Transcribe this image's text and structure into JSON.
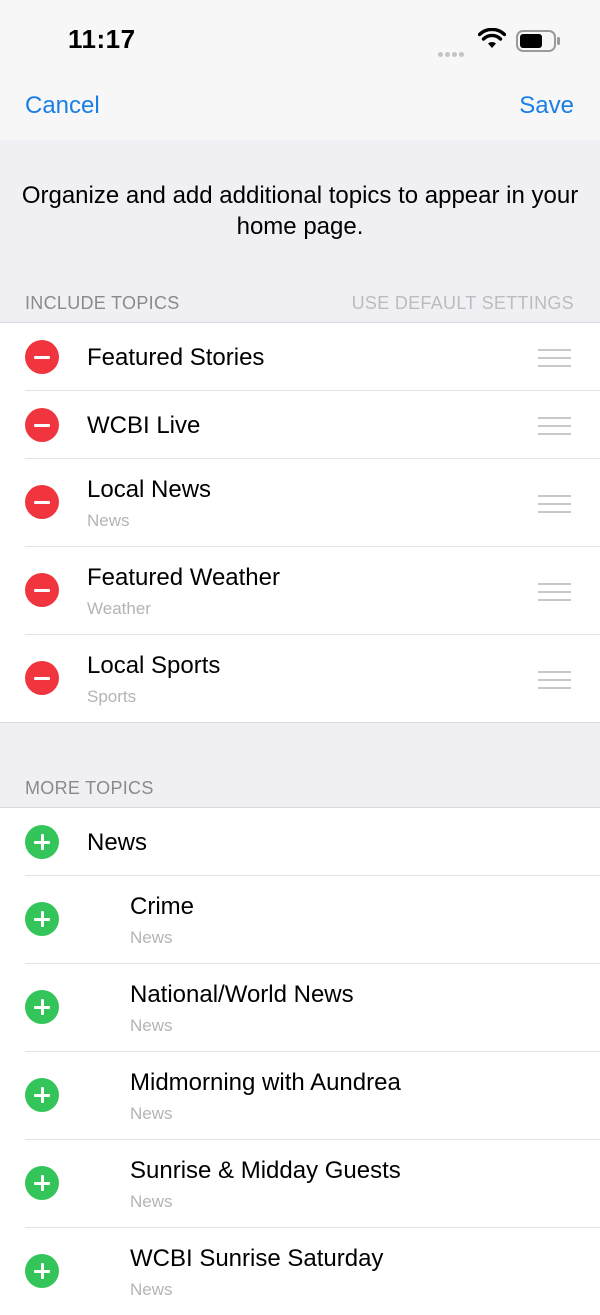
{
  "status": {
    "time": "11:17"
  },
  "nav": {
    "cancel": "Cancel",
    "save": "Save"
  },
  "intro": "Organize and add additional topics to appear in your home page.",
  "include": {
    "header": "INCLUDE TOPICS",
    "default_link": "USE DEFAULT SETTINGS",
    "items": [
      {
        "title": "Featured Stories",
        "sub": ""
      },
      {
        "title": "WCBI Live",
        "sub": ""
      },
      {
        "title": "Local News",
        "sub": "News"
      },
      {
        "title": "Featured Weather",
        "sub": "Weather"
      },
      {
        "title": "Local Sports",
        "sub": "Sports"
      }
    ]
  },
  "more": {
    "header": "MORE TOPICS",
    "items": [
      {
        "title": "News",
        "sub": ""
      },
      {
        "title": "Crime",
        "sub": "News"
      },
      {
        "title": "National/World News",
        "sub": "News"
      },
      {
        "title": "Midmorning with Aundrea",
        "sub": "News"
      },
      {
        "title": "Sunrise & Midday Guests",
        "sub": "News"
      },
      {
        "title": "WCBI Sunrise Saturday",
        "sub": "News"
      }
    ]
  },
  "colors": {
    "accent": "#1a7ee6",
    "remove": "#f1353f",
    "add": "#34c55a"
  }
}
